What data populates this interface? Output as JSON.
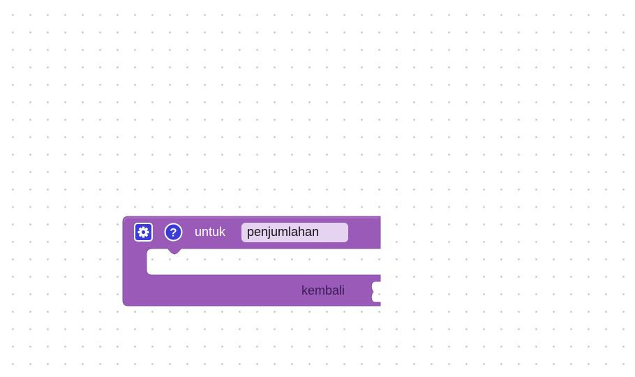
{
  "workspace": {
    "background": "white-with-dot-grid"
  },
  "block": {
    "type": "procedures_defreturn",
    "color": "#9a5ab8",
    "label_untuk": "untuk",
    "function_name": "penjumlahan",
    "label_kembali": "kembali",
    "icons": {
      "settings": "gear-icon",
      "help": "question-mark-icon",
      "accent": "#3b3bd9"
    }
  }
}
